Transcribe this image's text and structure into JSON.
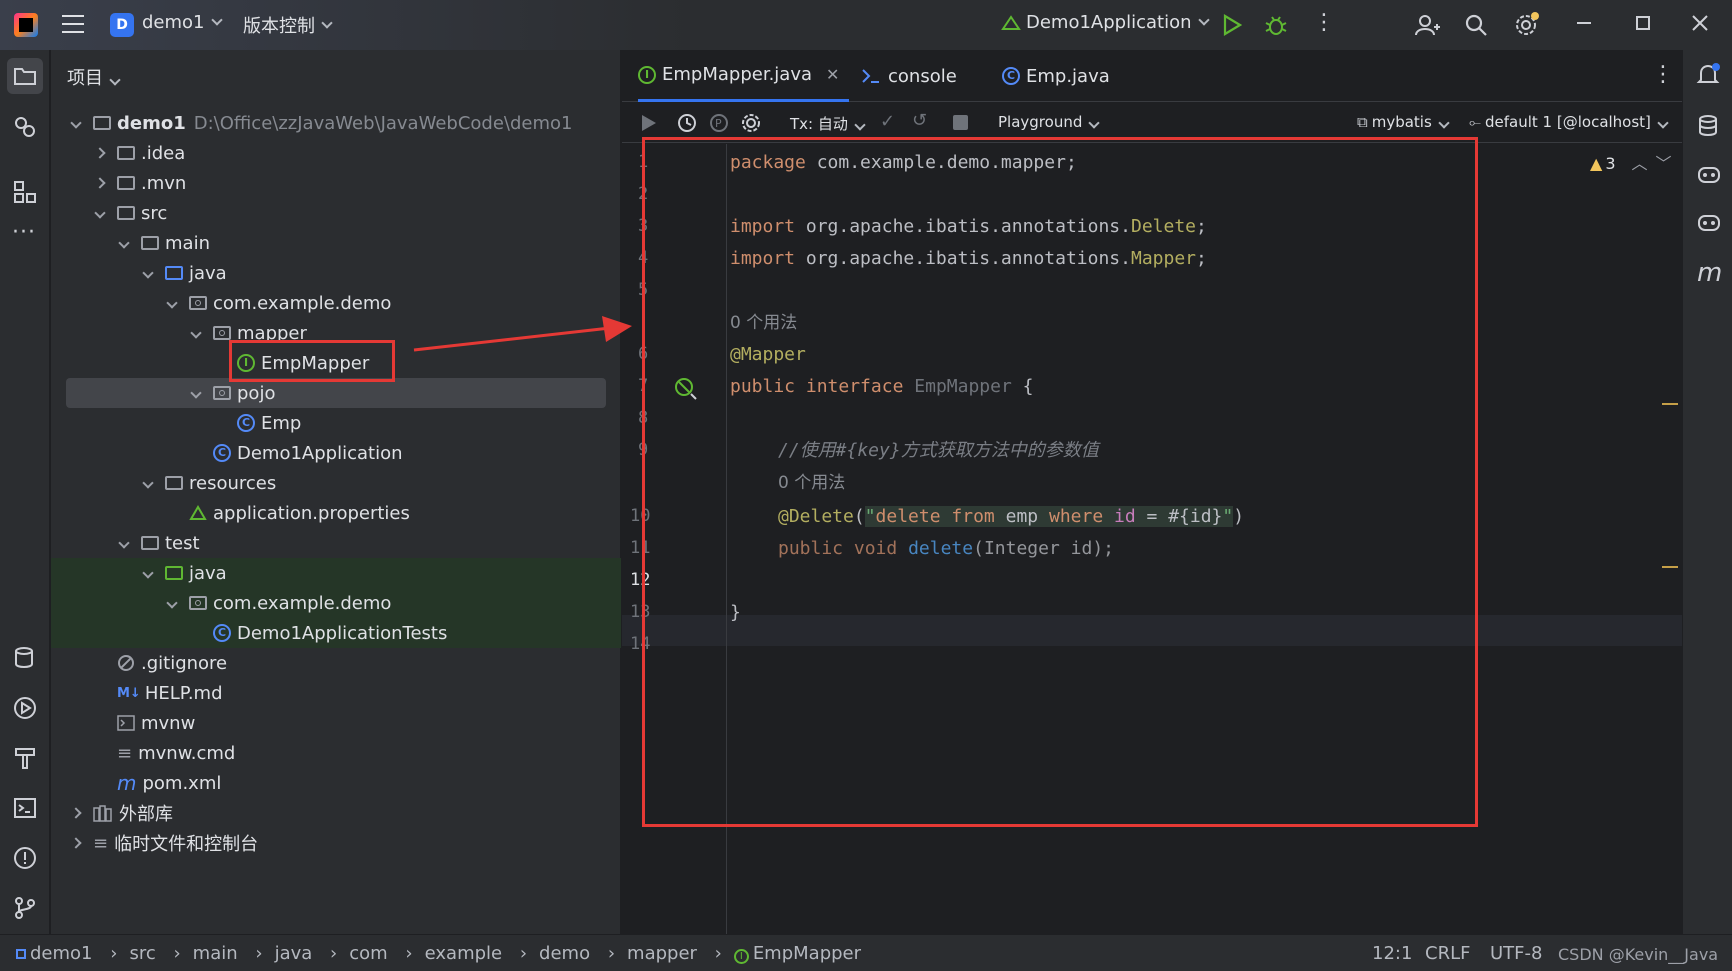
{
  "titlebar": {
    "project_badge": "D",
    "project_name": "demo1",
    "vcs_label": "版本控制",
    "run_config": "Demo1Application"
  },
  "project_panel": {
    "title": "项目",
    "root_name": "demo1",
    "root_path": "D:\\Office\\zzJavaWeb\\JavaWebCode\\demo1",
    "items": {
      "idea": ".idea",
      "mvn": ".mvn",
      "src": "src",
      "main": "main",
      "java": "java",
      "pkg": "com.example.demo",
      "mapper": "mapper",
      "empmapper": "EmpMapper",
      "pojo": "pojo",
      "emp": "Emp",
      "app": "Demo1Application",
      "resources": "resources",
      "props": "application.properties",
      "test": "test",
      "test_java": "java",
      "test_pkg": "com.example.demo",
      "tests": "Demo1ApplicationTests",
      "gitignore": ".gitignore",
      "help": "HELP.md",
      "mvnw": "mvnw",
      "mvnwcmd": "mvnw.cmd",
      "pom": "pom.xml",
      "ext_libs": "外部库",
      "scratches": "临时文件和控制台"
    }
  },
  "tabs": [
    {
      "label": "EmpMapper.java"
    },
    {
      "label": "console"
    },
    {
      "label": "Emp.java"
    }
  ],
  "editor_toolbar": {
    "tx": "Tx: 自动",
    "playground": "Playground",
    "datasource": "mybatis",
    "session": "default 1 [@localhost]",
    "warnings": "3"
  },
  "code": {
    "line_numbers": [
      "1",
      "2",
      "3",
      "4",
      "5",
      "6",
      "7",
      "8",
      "9",
      "10",
      "11",
      "12",
      "13",
      "14"
    ],
    "package_kw": "package",
    "package_name": " com.example.demo.mapper;",
    "import_kw": "import",
    "import1_prefix": " org.apache.ibatis.annotations.",
    "import1_cls": "Delete",
    "import2_prefix": " org.apache.ibatis.annotations.",
    "import2_cls": "Mapper",
    "semicolon": ";",
    "usages1": "0 个用法",
    "mapper_ann": "@Mapper",
    "public_kw": "public",
    "interface_kw": "interface",
    "iface_name": "EmpMapper",
    "brace_open": " {",
    "comment": "//使用#{key}方式获取方法中的参数值",
    "usages2": "0 个用法",
    "delete_ann": "@Delete",
    "paren_open": "(",
    "quote": "\"",
    "sql_delete": "delete",
    "sql_from": "from",
    "sql_emp": "emp",
    "sql_where": "where",
    "sql_id": "id",
    "sql_rest": " = #{id}",
    "paren_close": ")",
    "void_kw": "void",
    "method_name": "delete",
    "params": "(Integer id);",
    "brace_close": "}"
  },
  "statusbar": {
    "crumbs": [
      "demo1",
      "src",
      "main",
      "java",
      "com",
      "example",
      "demo",
      "mapper",
      "EmpMapper"
    ],
    "position": "12:1",
    "line_sep": "CRLF",
    "encoding": "UTF-8",
    "watermark": "CSDN @Kevin__Java"
  },
  "colors": {
    "accent": "#3574f0",
    "highlight_red": "#e53935"
  }
}
